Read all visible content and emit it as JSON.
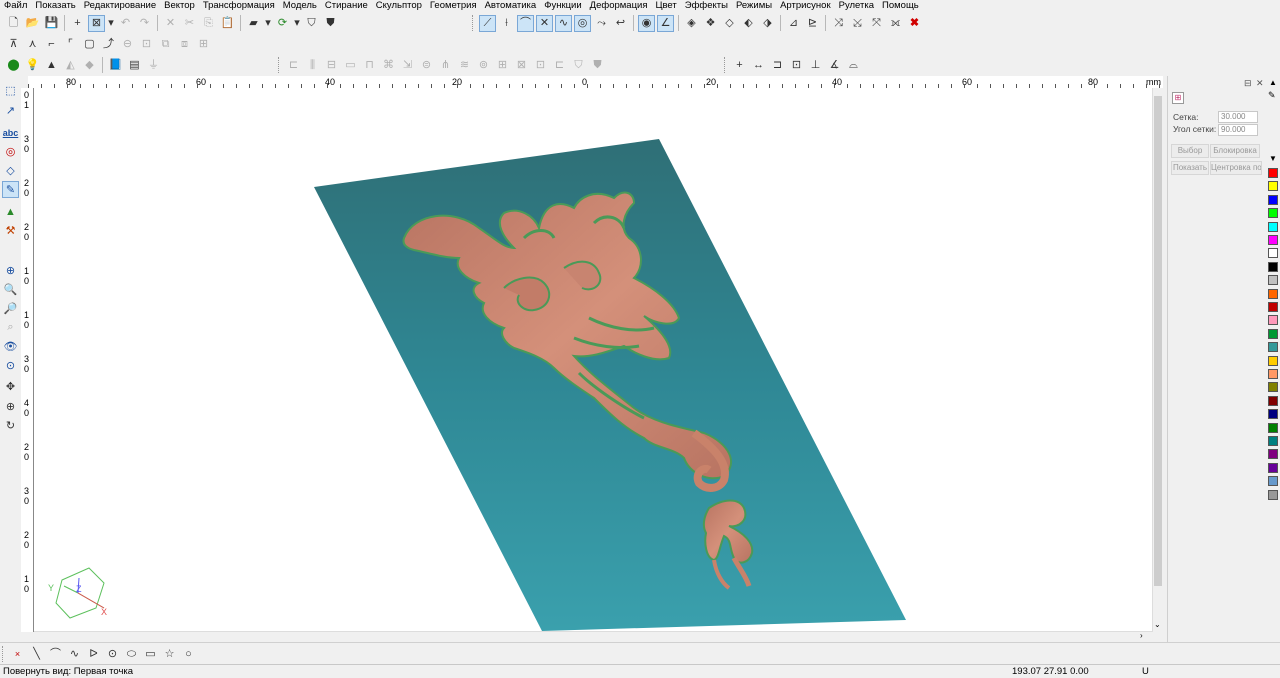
{
  "menu": [
    "Файл",
    "Показать",
    "Редактирование",
    "Вектор",
    "Трансформация",
    "Модель",
    "Стирание",
    "Скульптор",
    "Геометрия",
    "Автоматика",
    "Функции",
    "Деформация",
    "Цвет",
    "Эффекты",
    "Режимы",
    "Артрисунок",
    "Рулетка",
    "Помощь"
  ],
  "ruler": {
    "h_labels": [
      "80",
      "60",
      "40",
      "20",
      "0",
      "20",
      "40",
      "60",
      "80",
      "mm"
    ],
    "v_labels": [
      "0",
      "1",
      "3",
      "0",
      "2",
      "0",
      "2",
      "0",
      "1",
      "0",
      "1",
      "0",
      "3",
      "0",
      "4",
      "0",
      "2",
      "0",
      "3",
      "0",
      "2",
      "0",
      "1",
      "0"
    ]
  },
  "right_panel": {
    "grid_label": "Сетка:",
    "grid_value": "30.000",
    "angle_label": "Угол сетки:",
    "angle_value": "90.000",
    "select_btn": "Выбор",
    "lock_btn": "Блокировка",
    "show_btn": "Показать",
    "center_btn": "Центровка по"
  },
  "palette": [
    "#ff0000",
    "#ffff00",
    "#0000ff",
    "#00ff00",
    "#00ffff",
    "#ff00ff",
    "#ffffff",
    "#000000",
    "#c0c0c0",
    "#ff6600",
    "#c00000",
    "#ff99bb",
    "#009933",
    "#339999",
    "#ffcc00",
    "#ff9966",
    "#808000",
    "#800000",
    "#000080",
    "#008000",
    "#008080",
    "#800080",
    "#660099",
    "#6699cc",
    "#999999"
  ],
  "axes": {
    "x": "X",
    "y": "Y",
    "z": "Z"
  },
  "status": {
    "message": "Повернуть вид: Первая точка",
    "coords": "193.07 27.91 0.00",
    "units": "U"
  },
  "colors": {
    "base": "#2e8794",
    "relief": "#c9826a",
    "highlight": "#5aa86a"
  }
}
